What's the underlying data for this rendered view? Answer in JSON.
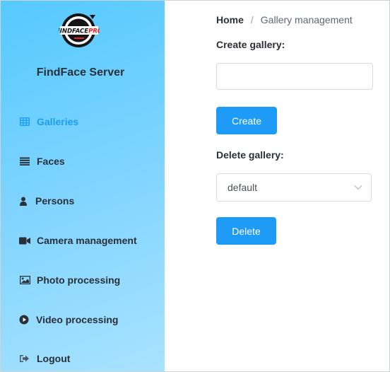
{
  "sidebar": {
    "logo_text": "FINDFACEPRO",
    "app_title": "FindFace Server",
    "items": [
      {
        "label": "Galleries",
        "icon": "grid-icon",
        "active": true
      },
      {
        "label": "Faces",
        "icon": "list-icon"
      },
      {
        "label": "Persons",
        "icon": "person-icon"
      },
      {
        "label": "Camera management",
        "icon": "video-camera-icon"
      },
      {
        "label": "Photo processing",
        "icon": "image-icon"
      },
      {
        "label": "Video processing",
        "icon": "play-circle-icon"
      },
      {
        "label": "Logout",
        "icon": "sign-out-icon"
      }
    ]
  },
  "breadcrumb": {
    "home": "Home",
    "separator": "/",
    "current": "Gallery management"
  },
  "create": {
    "label": "Create gallery:",
    "input_value": "",
    "button": "Create"
  },
  "delete": {
    "label": "Delete gallery:",
    "selected": "default",
    "button": "Delete"
  },
  "colors": {
    "accent": "#1e9bf6",
    "active_nav": "#1a9cf0",
    "sidebar_gradient_start": "#55c9ff",
    "sidebar_gradient_end": "#a9e2ff"
  }
}
